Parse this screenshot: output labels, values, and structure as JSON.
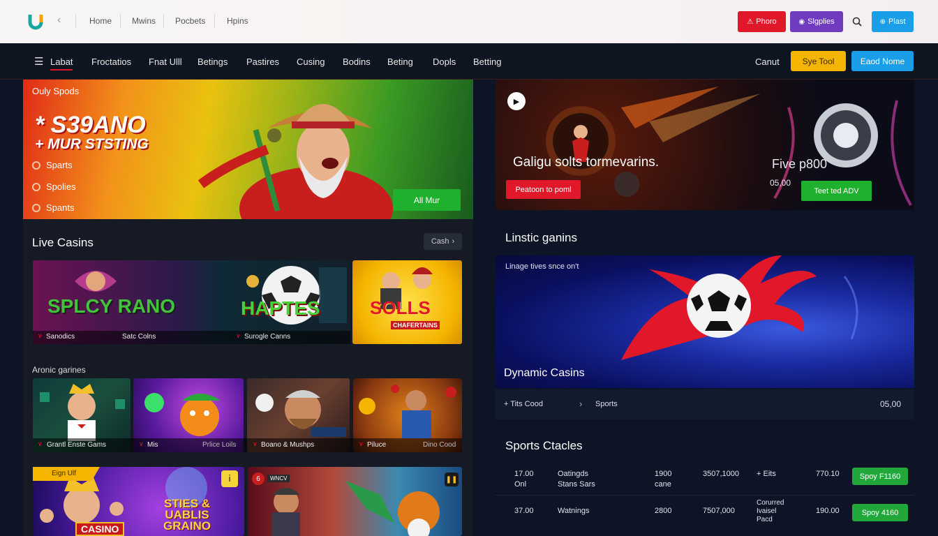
{
  "topbar": {
    "nav": [
      "Home",
      "Mwins",
      "Pocbets",
      "Hpins"
    ],
    "btn_red": "Phoro",
    "btn_purple": "Slgplies",
    "btn_blue": "Plast"
  },
  "nav": {
    "items": [
      "Labat",
      "Froctatios",
      "Fnat Ulll",
      "Betings",
      "Pastires",
      "Cusing",
      "Bodins",
      "Beting",
      "Dopls",
      "Betting"
    ],
    "right_text": "Canut",
    "btn_yellow": "Sye Tool",
    "btn_blue": "Eaod Nome"
  },
  "hero": {
    "kicker": "Ouly Spods",
    "title1": "* S39ANO",
    "title2": "+ MUR STSTING",
    "list": [
      "Sparts",
      "Spolies",
      "Spants"
    ],
    "cta": "All Mur"
  },
  "live": {
    "title": "Live Casins",
    "more": "Cash",
    "cards": [
      {
        "art": "SPLCY RANO",
        "cap_left": "Sanodics",
        "cap_right": "Satc Colns"
      },
      {
        "art": "HAPTES",
        "cap_left": "Surogle Canns",
        "cap_right": ""
      },
      {
        "art": "SOLLS",
        "art2": "CHAFERTAINS",
        "cap_left": "",
        "cap_right": ""
      }
    ]
  },
  "arcade": {
    "title": "Aronic garines",
    "cards": [
      {
        "cap_left": "Grantl Enste Gams",
        "cap_right": ""
      },
      {
        "cap_left": "Mis",
        "cap_right": "Prlice Loils"
      },
      {
        "cap_left": "Boano & Mushps",
        "cap_right": ""
      },
      {
        "cap_left": "Piluce",
        "cap_right": "Dino Cood"
      }
    ]
  },
  "bottom": {
    "tag": "Eign Ulf",
    "art1": "STIES & UABLIS GRAINO",
    "casino": "CASINO",
    "badge": "6",
    "mini_badge": "WNCV"
  },
  "promo": {
    "title": "Galigu solts tormevarins.",
    "cta": "Peatoon to poml",
    "right_title": "Five p800",
    "right_value": "05,00",
    "right_cta": "Teet ted ADV"
  },
  "linstic": {
    "title": "Linstic ganins",
    "subtitle": "Linage tives snce on't",
    "caption": "Dynamic Casins",
    "bar_left": "+ Tits Cood",
    "bar_mid": "Sports",
    "bar_right": "05,00"
  },
  "sports": {
    "title": "Sports Ctacles",
    "rows": [
      {
        "time": "17.00",
        "time2": "Onl",
        "event": "Oatingds",
        "event2": "Stans Sars",
        "c3": "1900",
        "c3b": "cane",
        "c4": "3507,1000",
        "c5": "+ Eits",
        "c5b": "",
        "c5c": "",
        "c6": "770.10",
        "btn": "Spoy F1160"
      },
      {
        "time": "37.00",
        "time2": "",
        "event": "Watnings",
        "event2": "",
        "c3": "2800",
        "c3b": "",
        "c4": "7507,000",
        "c5": "Corurred",
        "c5b": "Ivaisel",
        "c5c": "Pacd",
        "c6": "190.00",
        "btn": "Spoy 4160"
      }
    ]
  },
  "colors": {
    "accent_red": "#e0182a",
    "accent_purple": "#6f3cc0",
    "accent_blue": "#1a9ee8",
    "accent_yellow": "#f4b400",
    "accent_green": "#22a83a"
  }
}
